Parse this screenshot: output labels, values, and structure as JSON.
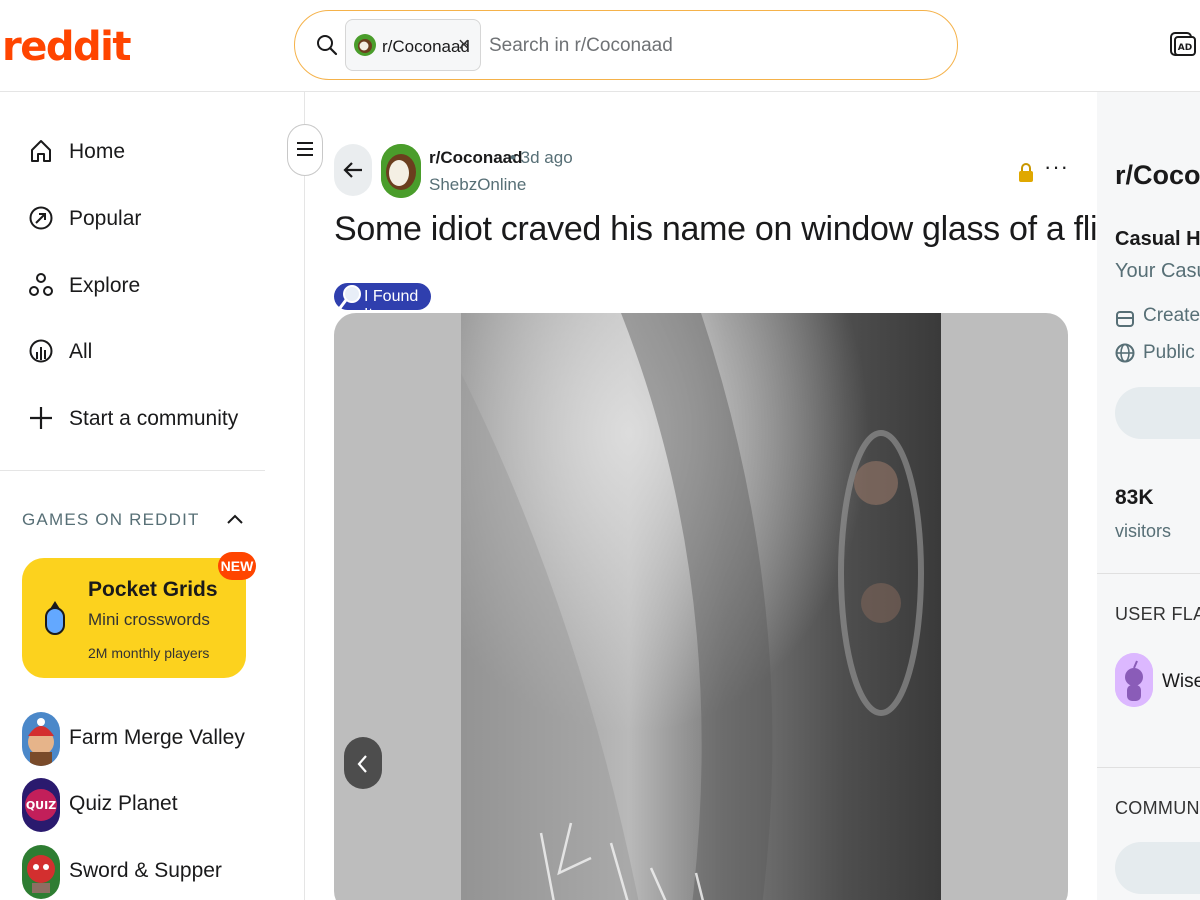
{
  "header": {
    "logo": "reddit",
    "search": {
      "chip_label": "r/Coconaad",
      "chip_close": "×",
      "placeholder": "Search in r/Coconaad",
      "icon": "search-icon"
    },
    "ad_icon": "advertise-icon"
  },
  "sidebar": {
    "nav": [
      {
        "label": "Home",
        "icon": "home-icon"
      },
      {
        "label": "Popular",
        "icon": "popular-icon"
      },
      {
        "label": "Explore",
        "icon": "explore-icon"
      },
      {
        "label": "All",
        "icon": "all-icon"
      },
      {
        "label": "Start a community",
        "icon": "plus-icon"
      }
    ],
    "games_heading": "GAMES ON REDDIT",
    "featured_game": {
      "title": "Pocket Grids",
      "subtitle": "Mini crosswords",
      "players": "2M monthly players",
      "badge": "NEW"
    },
    "games": [
      {
        "label": "Farm Merge Valley"
      },
      {
        "label": "Quiz Planet",
        "avatar_text": "QUIZ"
      },
      {
        "label": "Sword & Supper"
      }
    ]
  },
  "post": {
    "subreddit": "r/Coconaad",
    "time": "• 3d ago",
    "user": "ShebzOnline",
    "title": "Some idiot craved his name on window glass of a flight!",
    "flair": "I Found It",
    "more": "···"
  },
  "right_sidebar": {
    "title": "r/Coconaad",
    "subtitle": "Casual Hav",
    "description": "Your Casual",
    "created": "Created F",
    "visibility": "Public",
    "visitors_count": "83K",
    "visitors_label": "visitors",
    "user_flair_heading": "USER FLAIR",
    "flair_name": "Wise_",
    "community_heading": "COMMUNITY"
  },
  "colors": {
    "brand": "#ff4500",
    "search_border": "#f5b24a",
    "game_card": "#fcd21e",
    "flair_bg": "#2f3fae"
  }
}
